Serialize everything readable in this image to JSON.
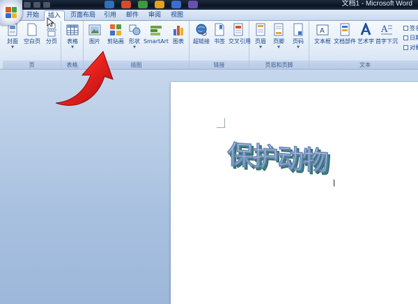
{
  "window": {
    "title": "文档1 - Microsoft Word"
  },
  "tabs": [
    {
      "label": "开始",
      "active": false
    },
    {
      "label": "插入",
      "active": true
    },
    {
      "label": "页面布局",
      "active": false
    },
    {
      "label": "引用",
      "active": false
    },
    {
      "label": "邮件",
      "active": false
    },
    {
      "label": "审阅",
      "active": false
    },
    {
      "label": "视图",
      "active": false
    }
  ],
  "ribbon": {
    "groups": {
      "pages": {
        "label": "页",
        "buttons": [
          "封面",
          "空白页",
          "分页"
        ]
      },
      "tables": {
        "label": "表格",
        "buttons": [
          "表格"
        ]
      },
      "illustrations": {
        "label": "插图",
        "buttons": [
          "图片",
          "剪贴画",
          "形状",
          "SmartArt",
          "图表"
        ]
      },
      "links": {
        "label": "链接",
        "buttons": [
          "超链接",
          "书签",
          "交叉引用"
        ]
      },
      "header_footer": {
        "label": "页眉和页脚",
        "buttons": [
          "页眉",
          "页脚",
          "页码"
        ]
      },
      "text": {
        "label": "文本",
        "buttons": [
          "文本框",
          "文档部件",
          "艺术字",
          "首字下沉"
        ],
        "small_buttons": [
          "签名",
          "日期",
          "对象"
        ]
      }
    }
  },
  "document": {
    "wordart_text": "保护动物"
  },
  "colors": {
    "accent": "#15428b",
    "arrow": "#e8211d",
    "wordart_face": "#b4c8e6",
    "wordart_side": "#3f8f8a"
  }
}
